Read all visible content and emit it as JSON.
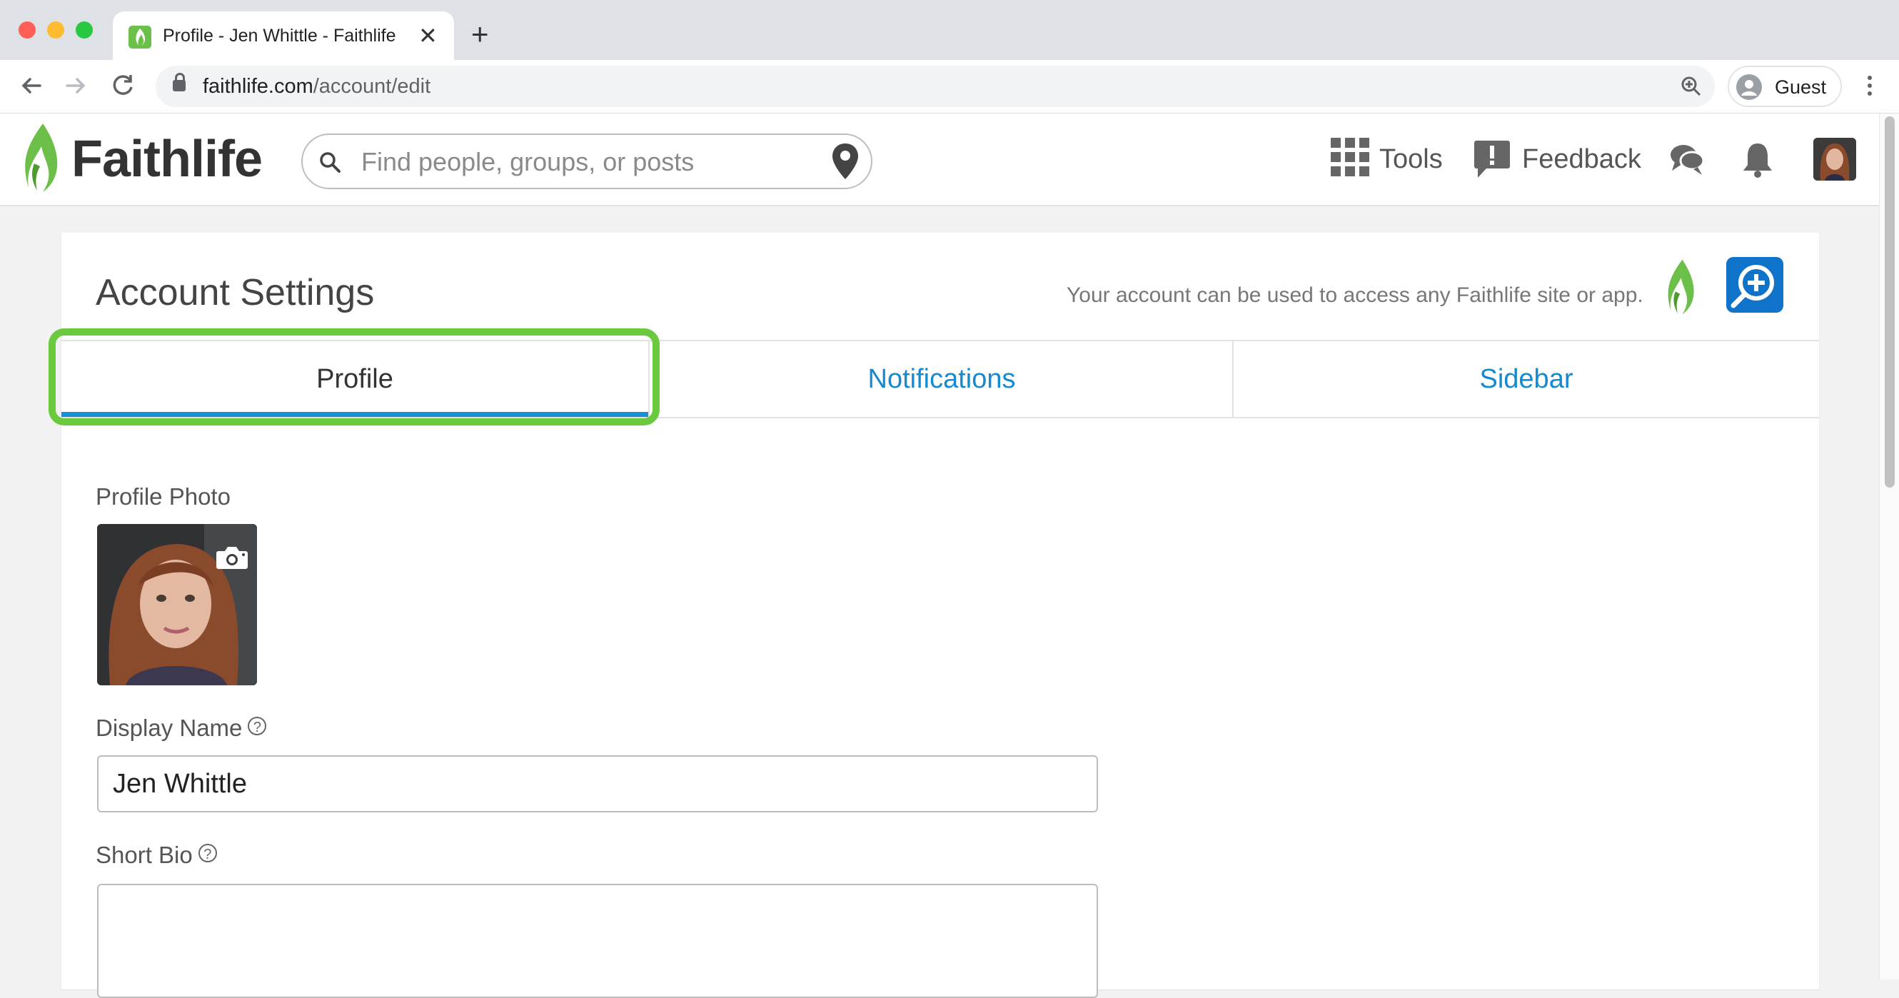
{
  "browser": {
    "tab_title": "Profile - Jen Whittle - Faithlife",
    "url_domain": "faithlife.com",
    "url_path": "/account/edit",
    "profile_label": "Guest"
  },
  "header": {
    "logo_text": "Faithlife",
    "search_placeholder": "Find people, groups, or posts",
    "tools_label": "Tools",
    "feedback_label": "Feedback"
  },
  "settings": {
    "title": "Account Settings",
    "note": "Your account can be used to access any Faithlife site or app.",
    "tabs": [
      {
        "label": "Profile",
        "active": true
      },
      {
        "label": "Notifications",
        "active": false
      },
      {
        "label": "Sidebar",
        "active": false
      }
    ],
    "profile_photo_label": "Profile Photo",
    "display_name_label": "Display Name",
    "display_name_value": "Jen Whittle",
    "short_bio_label": "Short Bio",
    "short_bio_value": ""
  },
  "colors": {
    "brand_green": "#6cc04a",
    "link_blue": "#1589d1",
    "highlight_green": "#6ac93c"
  },
  "icons": [
    "search-icon",
    "location-pin-icon",
    "tools-grid-icon",
    "feedback-icon",
    "messages-icon",
    "bell-icon",
    "camera-icon",
    "help-icon"
  ]
}
